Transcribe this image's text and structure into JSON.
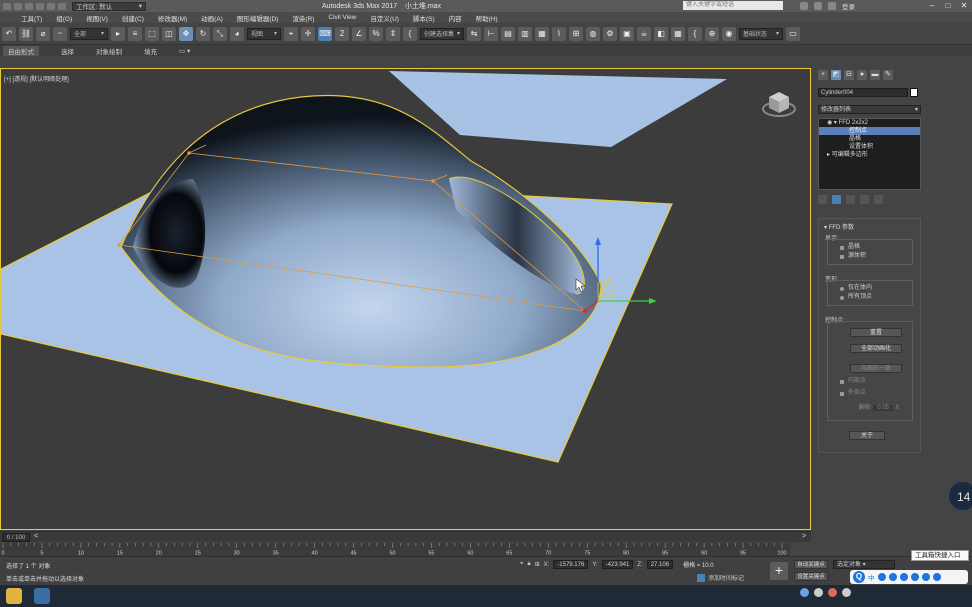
{
  "titlebar": {
    "workspace_label": "工作区: 默认",
    "app_title": "Autodesk 3ds Max 2017",
    "file_name": "小土堆.max",
    "search_placeholder": "键入关键字或短语",
    "login": "登录",
    "controls": [
      "–",
      "□",
      "✕"
    ]
  },
  "menubar": {
    "items": [
      "工具(T)",
      "组(G)",
      "视图(V)",
      "创建(C)",
      "修改器(M)",
      "动画(A)",
      "图形编辑器(D)",
      "渲染(R)",
      "Civil View",
      "自定义(U)",
      "脚本(S)",
      "内容",
      "帮助(H)"
    ]
  },
  "toolbar": {
    "filter_value": "全部",
    "coord_value": "视图",
    "named_sel_placeholder": "创建选择集",
    "state_value": "基础状态"
  },
  "ribbon": {
    "tabs": [
      "自由形式",
      "选择",
      "对象绘制",
      "填充"
    ]
  },
  "viewport": {
    "label": "[+] [透视] [默认明暗处理]"
  },
  "command_panel": {
    "object_name": "Cylinder004",
    "modifier_list": "修改器列表",
    "stack": {
      "items": [
        {
          "label": "FFD 2x2x2",
          "level": 0
        },
        {
          "label": "控制点",
          "level": 1,
          "highlighted": true
        },
        {
          "label": "晶格",
          "level": 1
        },
        {
          "label": "设置体积",
          "level": 1
        },
        {
          "label": "可编辑多边形",
          "level": 0
        }
      ]
    },
    "rollout": {
      "title": "FFD 参数",
      "display_label": "显示:",
      "display_opts": [
        "晶格",
        "源体积"
      ],
      "deform_label": "变形:",
      "deform_opts": [
        "仅在体内",
        "所有顶点"
      ],
      "cp_label": "控制点:",
      "reset_btn": "重置",
      "animate_btn": "全部动画化",
      "conform_btn": "与图形一致",
      "inner_pts": "内部点",
      "outer_pts": "外部点",
      "offset_label": "偏移:",
      "offset_value": "0.05",
      "about_btn": "关于"
    }
  },
  "timeline": {
    "range": "0 / 100",
    "ticks": [
      "0",
      "5",
      "10",
      "15",
      "20",
      "25",
      "30",
      "35",
      "40",
      "45",
      "50",
      "55",
      "60",
      "65",
      "70",
      "75",
      "80",
      "85",
      "90",
      "95",
      "100"
    ]
  },
  "status": {
    "selected": "选择了 1 个 对象",
    "prompt": "单击或单击并拖动以选择对象",
    "x_label": "X:",
    "x_value": "-1579.176",
    "y_label": "Y:",
    "y_value": "-423.941",
    "z_label": "Z:",
    "z_value": "27.106",
    "grid": "栅格 = 10.0",
    "add_time_tag": "添加时间标记",
    "auto_key": "自动关键点",
    "set_key": "设置关键点",
    "sel_filter": "选定对象",
    "keyfilters": "关键点过滤器"
  },
  "overlays": {
    "tooltip": "工具箱快捷入口",
    "badge": "14",
    "ime_text": "中"
  },
  "colors": {
    "accent": "#4d7fb4",
    "selection_outline": "#e8c93a",
    "mesh": "#a9c3e6"
  }
}
